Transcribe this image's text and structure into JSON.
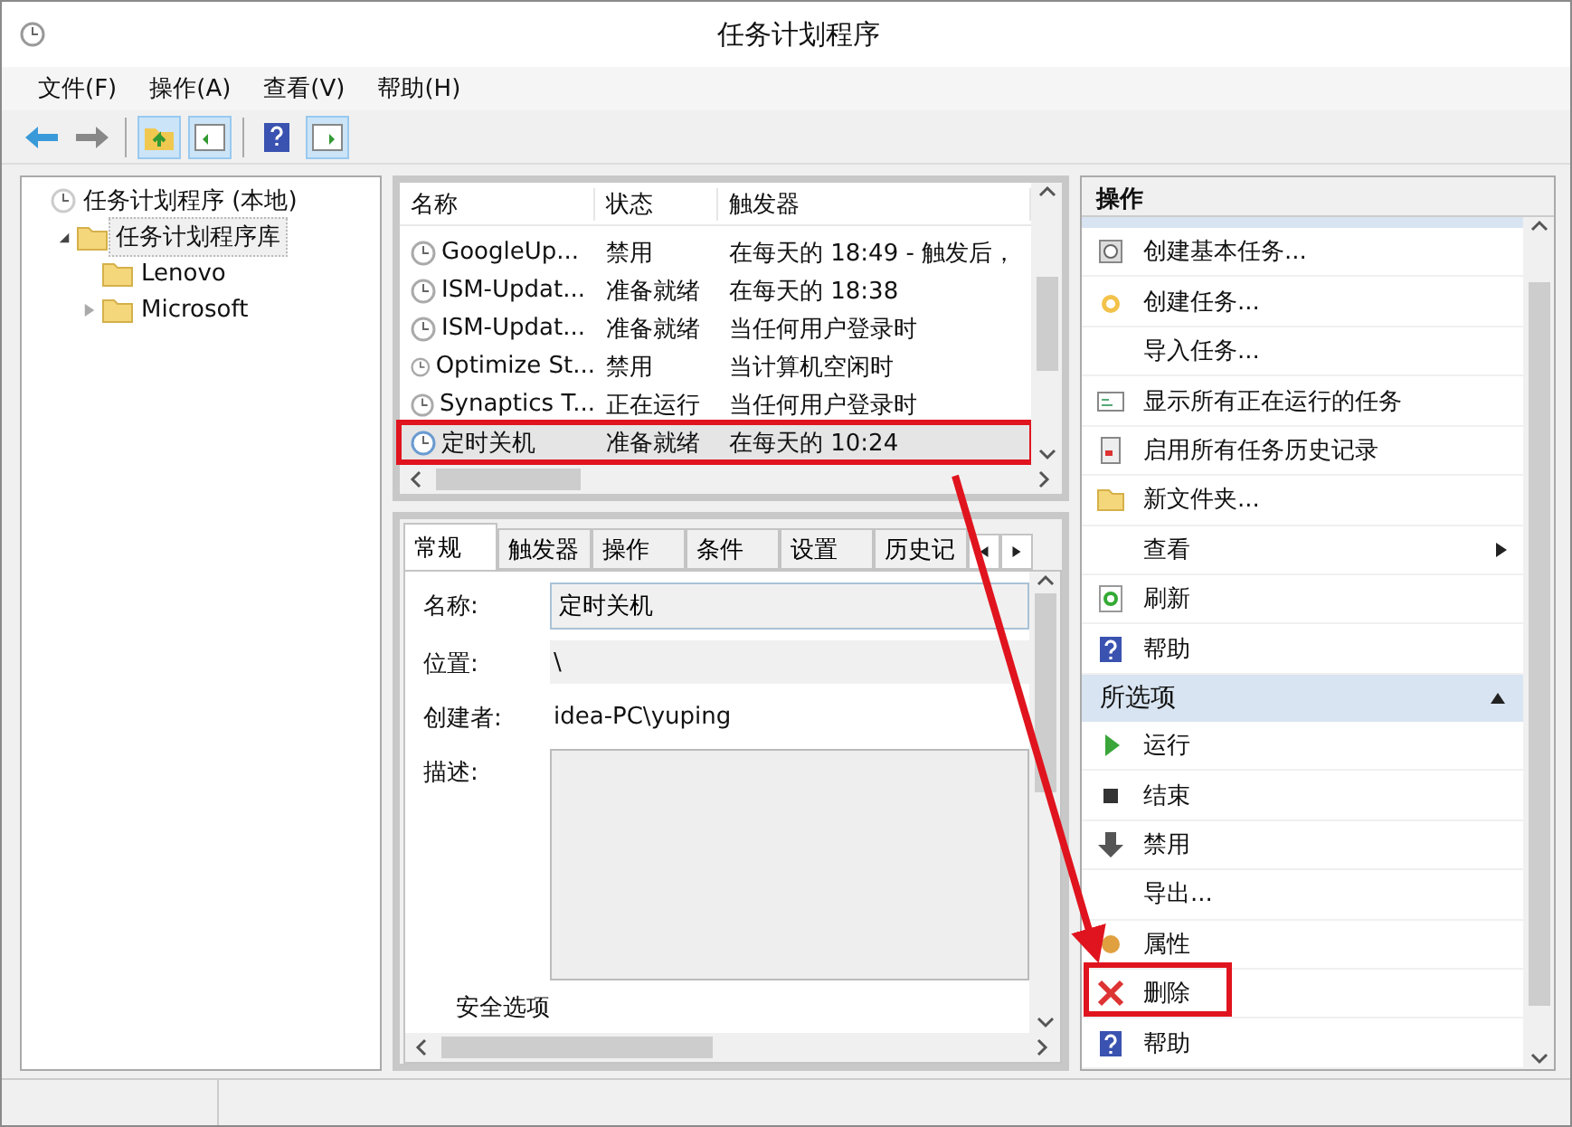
{
  "window": {
    "title": "任务计划程序"
  },
  "menu": [
    "文件(F)",
    "操作(A)",
    "查看(V)",
    "帮助(H)"
  ],
  "tree": [
    {
      "label": "任务计划程序 (本地)",
      "selected": false,
      "children": [
        {
          "label": "任务计划程序库",
          "selected": true,
          "expanded": true,
          "children": [
            {
              "label": "Lenovo",
              "selected": false
            },
            {
              "label": "Microsoft",
              "selected": false,
              "expanded": false
            }
          ]
        }
      ]
    }
  ],
  "task_list": {
    "columns": [
      "名称",
      "状态",
      "触发器"
    ],
    "rows": [
      {
        "name": "GoogleUp...",
        "status": "禁用",
        "trigger": "在每天的 18:49 - 触发后，",
        "selected": false
      },
      {
        "name": "ISM-Updat...",
        "status": "准备就绪",
        "trigger": "在每天的 18:38",
        "selected": false
      },
      {
        "name": "ISM-Updat...",
        "status": "准备就绪",
        "trigger": "当任何用户登录时",
        "selected": false
      },
      {
        "name": "Optimize St...",
        "status": "禁用",
        "trigger": "当计算机空闲时",
        "selected": false
      },
      {
        "name": "Synaptics T...",
        "status": "正在运行",
        "trigger": "当任何用户登录时",
        "selected": false
      },
      {
        "name": "定时关机",
        "status": "准备就绪",
        "trigger": "在每天的 10:24",
        "selected": true
      }
    ]
  },
  "details": {
    "tabs": [
      {
        "label": "常规",
        "selected": true
      },
      {
        "label": "触发器",
        "selected": false
      },
      {
        "label": "操作",
        "selected": false
      },
      {
        "label": "条件",
        "selected": false
      },
      {
        "label": "设置",
        "selected": false
      },
      {
        "label": "历史记",
        "selected": false
      }
    ],
    "name_label": "名称:",
    "name_value": "定时关机",
    "location_label": "位置:",
    "location_value": "\\",
    "author_label": "创建者:",
    "author_value": "idea-PC\\yuping",
    "description_label": "描述:",
    "security_label": "安全选项"
  },
  "actions": {
    "header": "操作",
    "sections": [
      {
        "expanded": true,
        "items": [
          {
            "label": "创建基本任务...",
            "kind": "action"
          },
          {
            "label": "创建任务...",
            "kind": "action"
          },
          {
            "label": "导入任务...",
            "kind": "action"
          },
          {
            "label": "显示所有正在运行的任务",
            "kind": "action"
          },
          {
            "label": "启用所有任务历史记录",
            "kind": "action"
          },
          {
            "label": "新文件夹...",
            "kind": "action"
          },
          {
            "label": "查看",
            "kind": "submenu"
          },
          {
            "label": "刷新",
            "kind": "action"
          },
          {
            "label": "帮助",
            "kind": "action"
          }
        ]
      },
      {
        "title": "所选项",
        "expanded": true,
        "items": [
          {
            "label": "运行",
            "kind": "action"
          },
          {
            "label": "结束",
            "kind": "action"
          },
          {
            "label": "禁用",
            "kind": "action"
          },
          {
            "label": "导出...",
            "kind": "action"
          },
          {
            "label": "属性",
            "kind": "action"
          },
          {
            "label": "删除",
            "kind": "action"
          },
          {
            "label": "帮助",
            "kind": "action"
          }
        ]
      }
    ]
  }
}
